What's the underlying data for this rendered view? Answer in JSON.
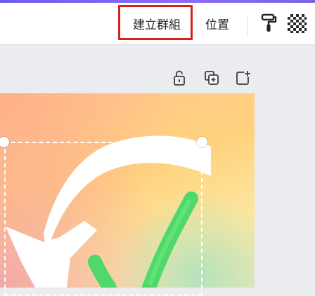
{
  "toolbar": {
    "group_label": "建立群組",
    "position_label": "位置",
    "copy_style_icon": "paint-roller-icon",
    "transparency_icon": "checkerboard-icon"
  },
  "page_actions": {
    "lock_icon": "unlock-icon",
    "duplicate_icon": "duplicate-page-icon",
    "add_icon": "add-page-icon"
  },
  "colors": {
    "accent": "#6b5cf0",
    "highlight": "#d9201a",
    "check_green": "#4fd96a"
  }
}
